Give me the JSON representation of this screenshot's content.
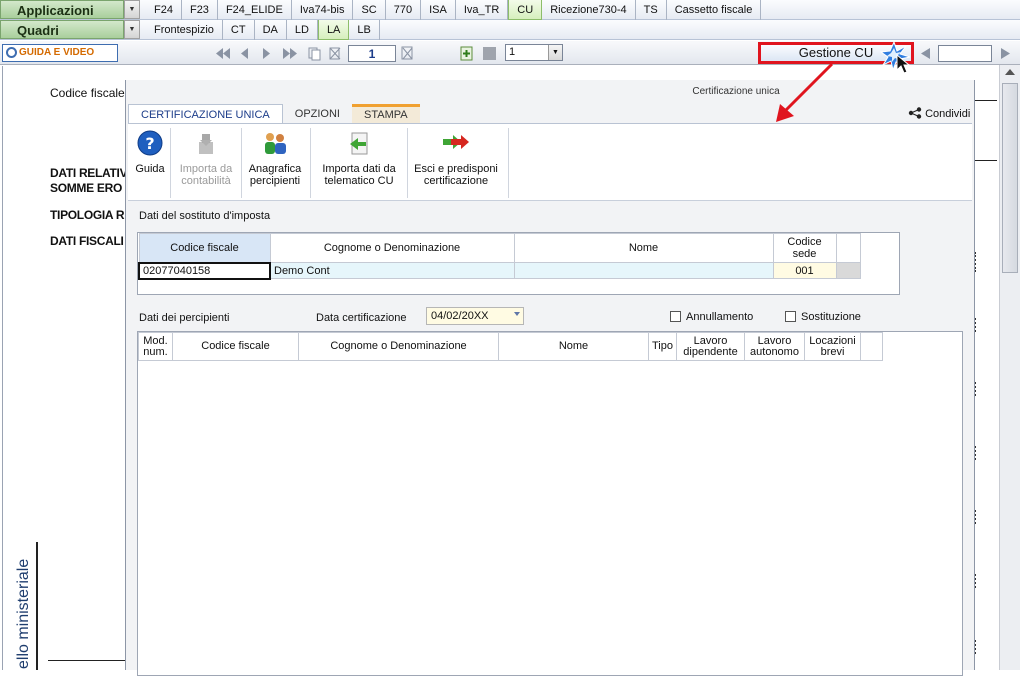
{
  "menu": {
    "applicazioni_label": "Applicazioni",
    "quadri_label": "Quadri",
    "app_tabs": [
      "F24",
      "F23",
      "F24_ELIDE",
      "Iva74-bis",
      "SC",
      "770",
      "ISA",
      "Iva_TR",
      "CU",
      "Ricezione730-4",
      "TS",
      "Cassetto fiscale"
    ],
    "app_tab_selected": "CU",
    "quadri_tabs": [
      "Frontespizio",
      "CT",
      "DA",
      "LD",
      "LA",
      "LB"
    ],
    "quadri_tab_selected": "LA"
  },
  "toolbar": {
    "guida_label": "GUIDA E VIDEO",
    "page_number": "1",
    "select_value": "1",
    "gestione_label": "Gestione CU"
  },
  "document": {
    "codice_fiscale_label": "Codice fiscale",
    "dati_relativi_1": "DATI RELATIV",
    "dati_relativi_2": "SOMME ERO",
    "tipologia": "TIPOLOGIA RE",
    "dati_fiscali": "DATI FISCALI",
    "vertical_text": "ello ministeriale"
  },
  "modal": {
    "title": "Certificazione unica",
    "tabs": [
      "CERTIFICAZIONE UNICA",
      "OPZIONI",
      "STAMPA"
    ],
    "condividi_label": "Condividi",
    "ribbon": {
      "guida": "Guida",
      "importa_contabilita_1": "Importa da",
      "importa_contabilita_2": "contabilità",
      "anagrafica_1": "Anagrafica",
      "anagrafica_2": "percipienti",
      "importa_telematico_1": "Importa dati da",
      "importa_telematico_2": "telematico CU",
      "esci_1": "Esci e predisponi",
      "esci_2": "certificazione"
    },
    "sostituto": {
      "section_label": "Dati del sostituto d'imposta",
      "headers": {
        "codice_fiscale": "Codice fiscale",
        "cognome": "Cognome o Denominazione",
        "nome": "Nome",
        "codice_sede_1": "Codice",
        "codice_sede_2": "sede"
      },
      "row": {
        "codice_fiscale": "02077040158",
        "cognome": "Demo Cont",
        "nome": "",
        "codice_sede": "001"
      }
    },
    "percipienti": {
      "section_label": "Dati dei percipienti",
      "data_cert_label": "Data certificazione",
      "data_cert_value": "04/02/20XX",
      "annullamento_label": "Annullamento",
      "sostituzione_label": "Sostituzione",
      "headers": {
        "mod_1": "Mod.",
        "mod_2": "num.",
        "codice_fiscale": "Codice fiscale",
        "cognome": "Cognome o Denominazione",
        "nome": "Nome",
        "tipo": "Tipo",
        "lav_dip_1": "Lavoro",
        "lav_dip_2": "dipendente",
        "lav_aut_1": "Lavoro",
        "lav_aut_2": "autonomo",
        "loc_1": "Locazioni",
        "loc_2": "brevi"
      }
    }
  },
  "colors": {
    "highlight_red": "#e0141e",
    "menu_green": "#a9cf9c",
    "accent_blue": "#1c3d8a"
  }
}
